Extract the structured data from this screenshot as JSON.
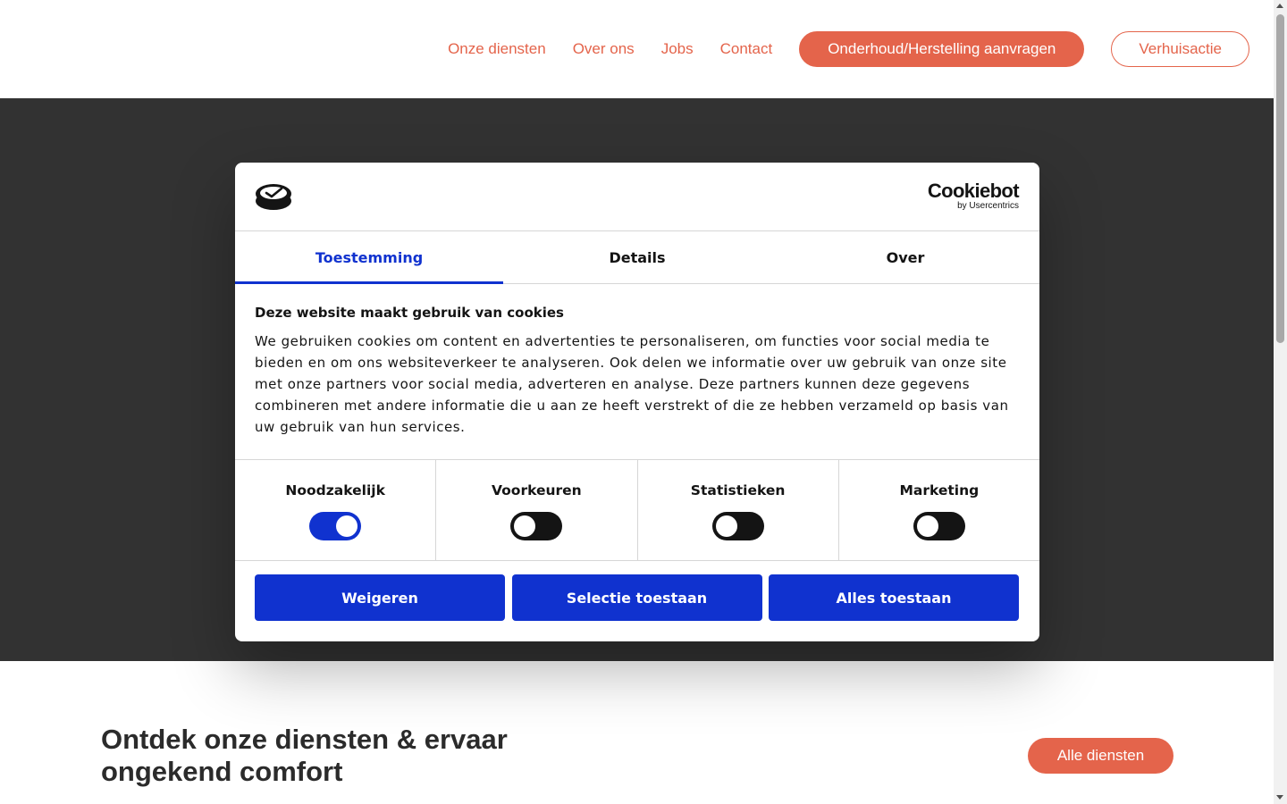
{
  "header": {
    "nav": [
      {
        "label": "Onze diensten"
      },
      {
        "label": "Over ons"
      },
      {
        "label": "Jobs"
      },
      {
        "label": "Contact"
      }
    ],
    "cta_primary": "Onderhoud/Herstelling aanvragen",
    "cta_secondary": "Verhuisactie"
  },
  "cookie_dialog": {
    "logo_word": "Cookiebot",
    "logo_sub": "by Usercentrics",
    "tabs": [
      {
        "label": "Toestemming",
        "active": true
      },
      {
        "label": "Details",
        "active": false
      },
      {
        "label": "Over",
        "active": false
      }
    ],
    "title": "Deze website maakt gebruik van cookies",
    "body": "We gebruiken cookies om content en advertenties te personaliseren, om functies voor social media te bieden en om ons websiteverkeer te analyseren. Ook delen we informatie over uw gebruik van onze site met onze partners voor social media, adverteren en analyse. Deze partners kunnen deze gegevens combineren met andere informatie die u aan ze heeft verstrekt of die ze hebben verzameld op basis van uw gebruik van hun services.",
    "toggles": [
      {
        "label": "Noodzakelijk",
        "checked": true
      },
      {
        "label": "Voorkeuren",
        "checked": false
      },
      {
        "label": "Statistieken",
        "checked": false
      },
      {
        "label": "Marketing",
        "checked": false
      }
    ],
    "buttons": {
      "decline": "Weigeren",
      "allow_selection": "Selectie toestaan",
      "allow_all": "Alles toestaan"
    }
  },
  "services": {
    "title": "Ontdek onze diensten & ervaar ongekend comfort",
    "all_button": "Alle diensten"
  },
  "colors": {
    "brand": "#e4644b",
    "consent_blue": "#1032cf",
    "hero_bg": "#323232"
  }
}
